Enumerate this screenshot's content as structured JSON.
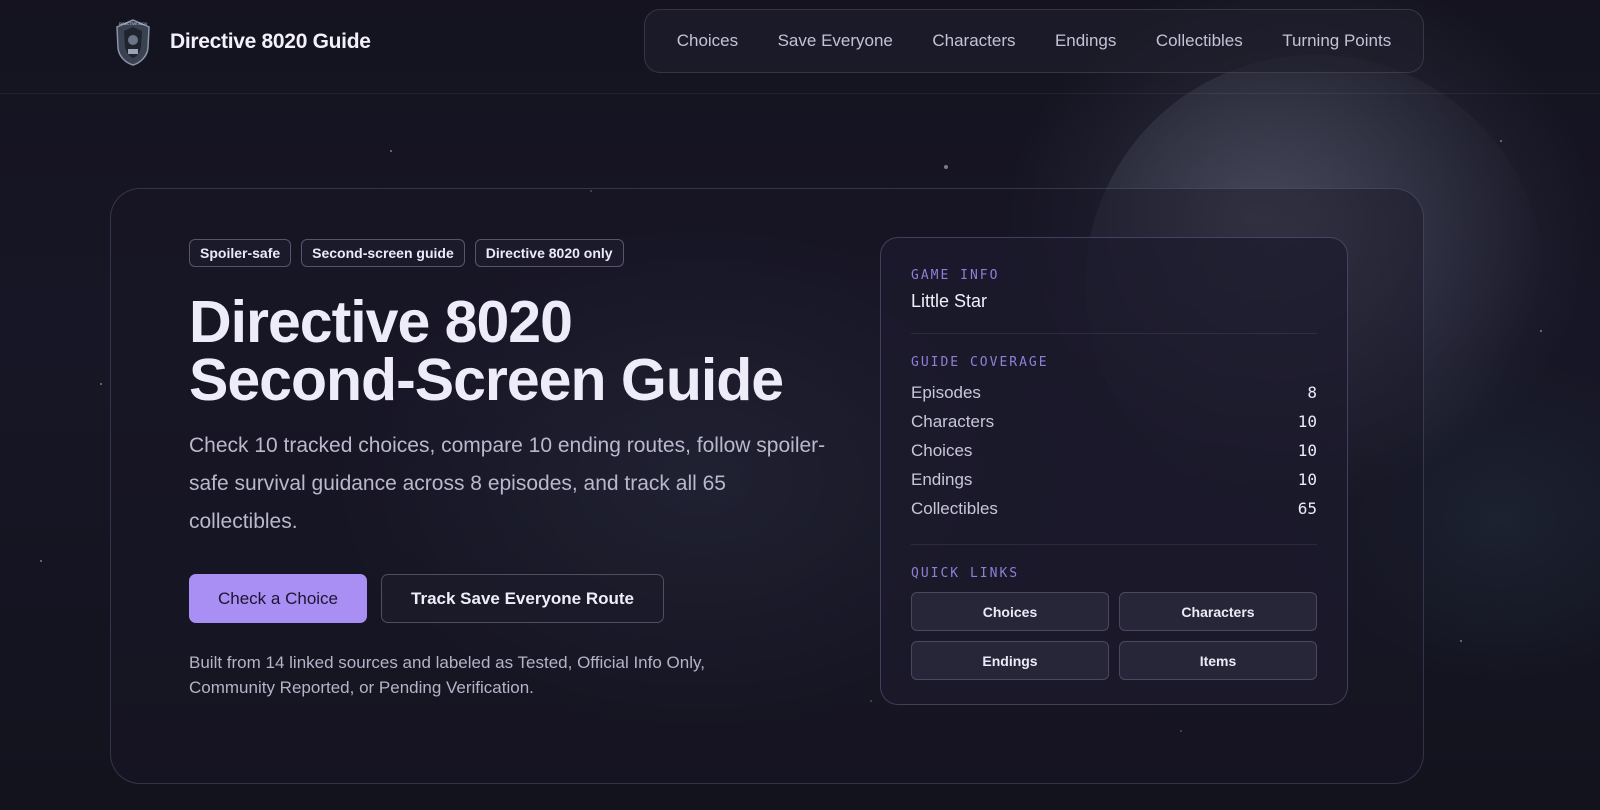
{
  "header": {
    "brand_name": "Directive 8020 Guide",
    "logo_text": "DIRECTIVE 8020",
    "nav": [
      "Choices",
      "Save Everyone",
      "Characters",
      "Endings",
      "Collectibles",
      "Turning Points"
    ]
  },
  "hero": {
    "tags": [
      "Spoiler-safe",
      "Second-screen guide",
      "Directive 8020 only"
    ],
    "title_line1": "Directive 8020",
    "title_line2": "Second-Screen Guide",
    "description": "Check 10 tracked choices, compare 10 ending routes, follow spoiler-safe survival guidance across 8 episodes, and track all 65 collectibles.",
    "primary_button": "Check a Choice",
    "secondary_button": "Track Save Everyone Route",
    "note": "Built from 14 linked sources and labeled as Tested, Official Info Only, Community Reported, or Pending Verification."
  },
  "panel": {
    "game_info_label": "GAME INFO",
    "game_name": "Little Star",
    "coverage_label": "GUIDE COVERAGE",
    "stats": [
      {
        "label": "Episodes",
        "value": "8"
      },
      {
        "label": "Characters",
        "value": "10"
      },
      {
        "label": "Choices",
        "value": "10"
      },
      {
        "label": "Endings",
        "value": "10"
      },
      {
        "label": "Collectibles",
        "value": "65"
      }
    ],
    "quick_links_label": "QUICK LINKS",
    "quick_links": [
      "Choices",
      "Characters",
      "Endings",
      "Items"
    ]
  },
  "colors": {
    "accent": "#a98ef3",
    "section_label": "#8f7fd6",
    "background": "#161523"
  }
}
